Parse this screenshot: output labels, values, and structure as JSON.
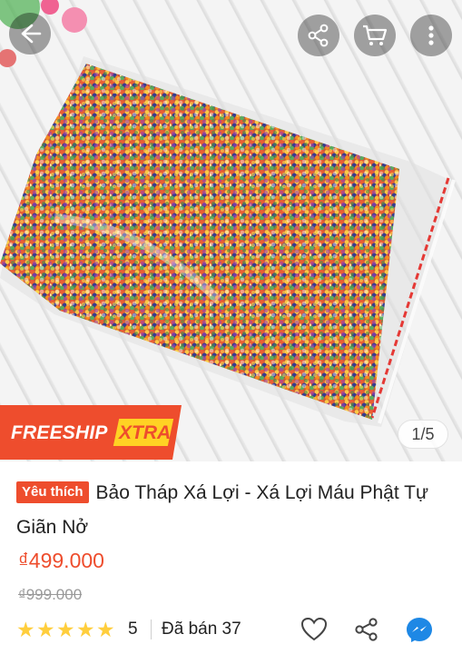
{
  "header": {
    "back_icon": "arrow-left-icon",
    "share_icon": "share-icon",
    "cart_icon": "cart-icon",
    "more_icon": "more-vertical-icon"
  },
  "gallery": {
    "badge_freeship": "FREESHIP",
    "badge_xtra": "XTRA",
    "counter": "1/5"
  },
  "product": {
    "favorite_badge": "Yêu thích",
    "title": "Bảo Tháp Xá Lợi - Xá Lợi Máu Phật Tự Giãn Nở",
    "price": "₫499.000",
    "original_price": "₫999.000",
    "rating": "5",
    "sold": "Đã bán 37"
  },
  "actions": {
    "like_icon": "heart-icon",
    "share_icon": "share-icon",
    "chat_icon": "messenger-icon"
  },
  "colors": {
    "accent": "#ee4d2d",
    "star": "#ffce3d",
    "xtra": "#ffd224"
  }
}
